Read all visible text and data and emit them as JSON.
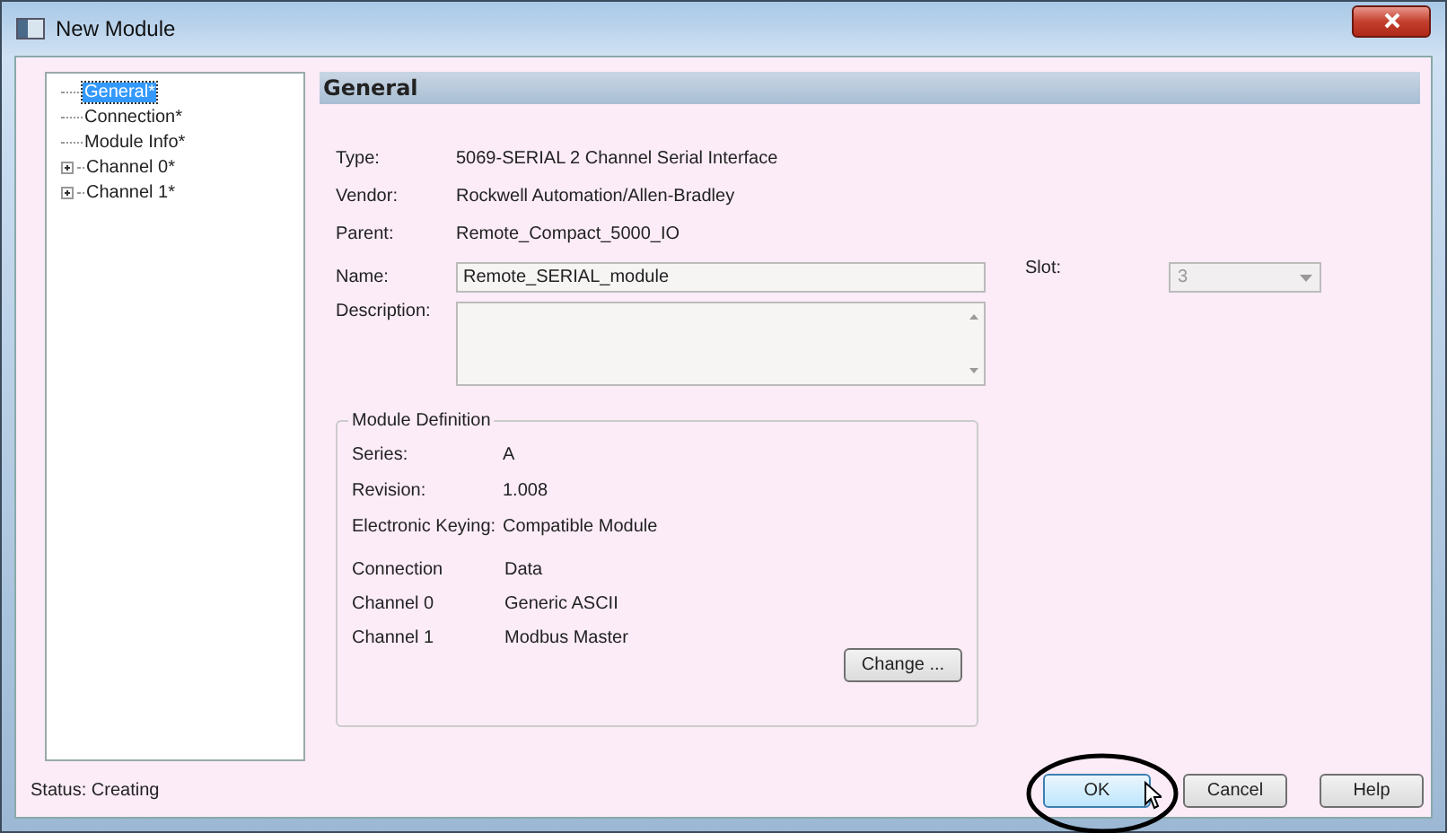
{
  "window": {
    "title": "New Module"
  },
  "tree": [
    {
      "label": "General*",
      "kind": "leaf",
      "selected": true
    },
    {
      "label": "Connection*",
      "kind": "leaf",
      "selected": false
    },
    {
      "label": "Module Info*",
      "kind": "leaf",
      "selected": false
    },
    {
      "label": "Channel 0*",
      "kind": "folder",
      "expanded": false,
      "selected": false
    },
    {
      "label": "Channel 1*",
      "kind": "folder",
      "expanded": false,
      "selected": false
    }
  ],
  "section_title": "General",
  "info": [
    {
      "label": "Type:",
      "value": "5069-SERIAL 2 Channel Serial Interface"
    },
    {
      "label": "Vendor:",
      "value": "Rockwell Automation/Allen-Bradley"
    },
    {
      "label": "Parent:",
      "value": "Remote_Compact_5000_IO"
    }
  ],
  "name": {
    "label": "Name:",
    "value": "Remote_SERIAL_module"
  },
  "slot": {
    "label": "Slot:",
    "value": "3",
    "disabled": true
  },
  "description": {
    "label": "Description:"
  },
  "module_definition": {
    "title": "Module Definition",
    "rows": [
      {
        "label": "Series:",
        "value": "A"
      },
      {
        "label": "Revision:",
        "value": "1.008"
      },
      {
        "label": "Electronic Keying:",
        "value": "Compatible Module"
      }
    ],
    "connections": [
      {
        "label": "Connection",
        "value": "Data"
      },
      {
        "label": "Channel 0",
        "value": "Generic ASCII"
      },
      {
        "label": "Channel 1",
        "value": "Modbus Master"
      }
    ],
    "change_button": "Change ..."
  },
  "status": "Status: Creating",
  "buttons": [
    {
      "label": "OK",
      "selected": true
    },
    {
      "label": "Cancel",
      "selected": false
    },
    {
      "label": "Help",
      "selected": false
    }
  ]
}
